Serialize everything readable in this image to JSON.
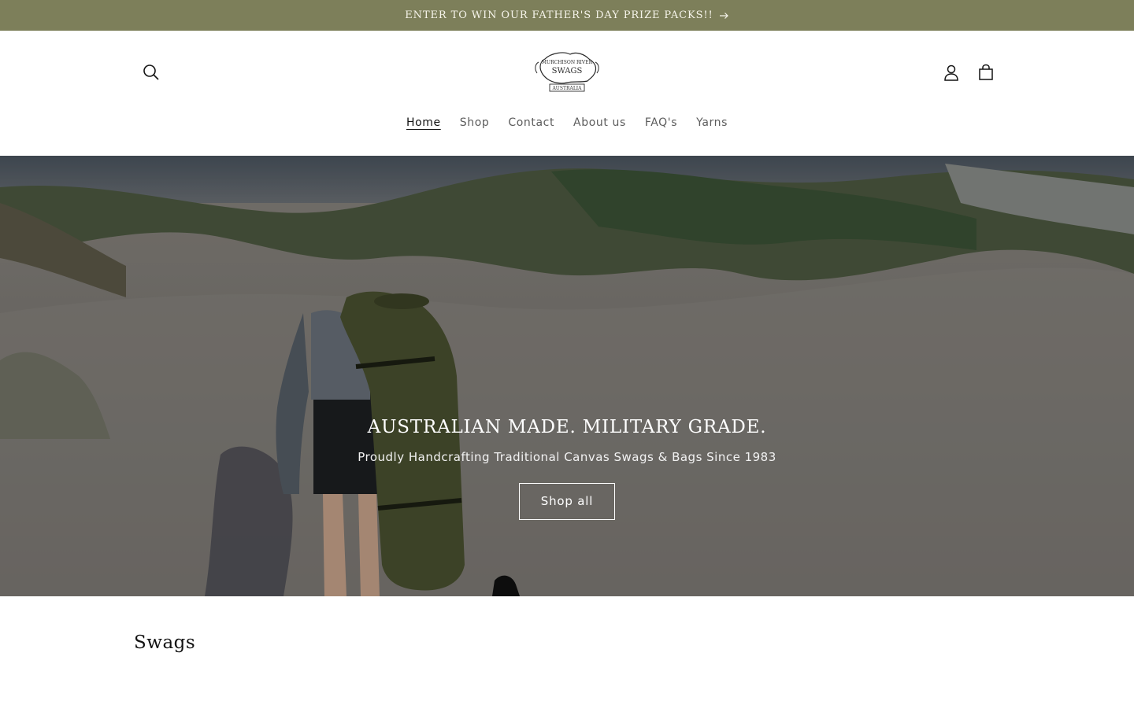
{
  "announcement": {
    "text": "ENTER TO WIN OUR FATHER'S DAY PRIZE PACKS!!",
    "icon": "arrow-right-icon"
  },
  "header": {
    "search_icon": "search-icon",
    "account_icon": "account-icon",
    "cart_icon": "cart-icon",
    "logo": {
      "line1": "MURCHISON RIVER",
      "line2": "SWAGS",
      "line3": "AUSTRALIA"
    }
  },
  "nav": {
    "items": [
      {
        "label": "Home",
        "active": true
      },
      {
        "label": "Shop"
      },
      {
        "label": "Contact"
      },
      {
        "label": "About us"
      },
      {
        "label": "FAQ's"
      },
      {
        "label": "Yarns"
      }
    ]
  },
  "hero": {
    "title": "AUSTRALIAN MADE. MILITARY GRADE.",
    "subtitle": "Proudly Handcrafting Traditional Canvas Swags & Bags Since 1983",
    "button_label": "Shop all"
  },
  "section": {
    "title": "Swags"
  },
  "colors": {
    "announcement_bg": "#7d7f5a",
    "text": "#121212"
  }
}
